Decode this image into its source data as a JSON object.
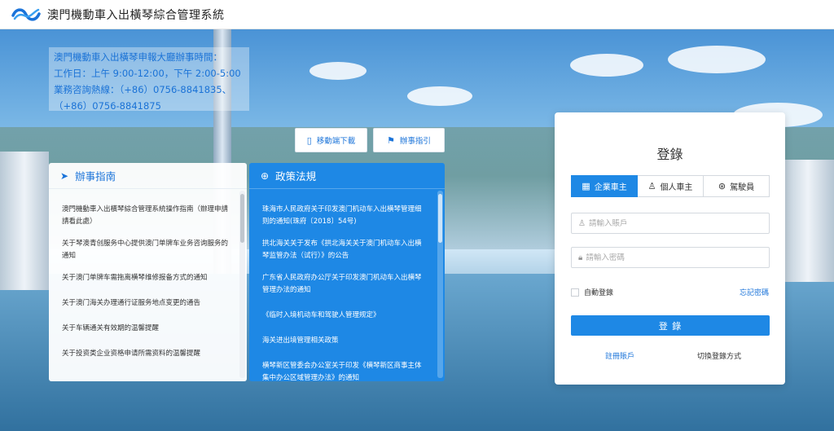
{
  "header": {
    "title": "澳門機動車入出橫琴綜合管理系統"
  },
  "notice": {
    "line1": "澳門機動車入出橫琴申報大廳辦事時間：",
    "line2": "工作日：上午 9:00-12:00，下午 2:00-5:00",
    "line3": "業務咨詢熱線：（+86）0756-8841835、",
    "line4": "（+86）0756-8841875"
  },
  "buttons": {
    "mobile_download": "移動端下載",
    "guide": "辦事指引"
  },
  "guide_panel": {
    "title": "辦事指南",
    "items": [
      "澳門機動車入出橫琴綜合管理系統操作指南（辦理申請請看此處）",
      "关于琴澳青创服务中心提供澳门单牌车业务咨询服务的通知",
      "关于澳门单牌车需拖离横琴维修报备方式的通知",
      "关于澳门海关办理通行证服务地点变更的通告",
      "关于车辆通关有效期的温馨提醒",
      "关于投资类企业资格申请所需资料的温馨提醒"
    ]
  },
  "policy_panel": {
    "title": "政策法規",
    "items": [
      "珠海市人民政府关于印发澳门机动车入出横琴管理细则的通知(珠府〔2018〕54号)",
      "拱北海关关于发布《拱北海关关于澳门机动车入出横琴监管办法（试行）》的公告",
      "广东省人民政府办公厅关于印发澳门机动车入出横琴管理办法的通知",
      "《临时入境机动车和驾驶人管理规定》",
      "海关进出境管理相关政策",
      "横琴新区管委会办公室关于印发《横琴新区商事主体集中办公区域管理办法》的通知"
    ]
  },
  "login": {
    "title": "登錄",
    "tabs": [
      "企業車主",
      "個人車主",
      "駕駛員"
    ],
    "account_placeholder": "請輸入賬戶",
    "password_placeholder": "請輸入密碼",
    "remember": "自動登錄",
    "forgot": "忘記密碼",
    "submit": "登 錄",
    "register": "註冊賬戶",
    "switch": "切換登錄方式"
  }
}
